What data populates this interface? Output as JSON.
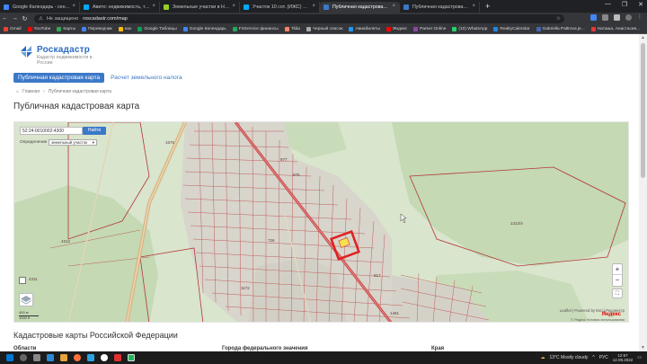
{
  "browser": {
    "tabs": [
      {
        "label": "Google Календарь - сентябрь",
        "color": "#4285f4"
      },
      {
        "label": "Авито: недвижимость, транспо",
        "color": "#00aaff"
      },
      {
        "label": "Земельные участки в Нижнем",
        "color": "#97cf26"
      },
      {
        "label": "Участок 10 сот. (ИЖС) на прод",
        "color": "#00aaff"
      },
      {
        "label": "Публичная кадастровая карта",
        "color": "#3c78c8"
      },
      {
        "label": "Публичная кадастровая карта",
        "color": "#3c78c8"
      }
    ],
    "active_tab": 4,
    "not_secure": "Не защищено",
    "url": "roscadastr.com/map",
    "bookmarks": [
      {
        "label": "Gmail",
        "color": "#ea4335"
      },
      {
        "label": "YouTube",
        "color": "#ff0000"
      },
      {
        "label": "Карты",
        "color": "#34a853"
      },
      {
        "label": "Переводчик",
        "color": "#4285f4"
      },
      {
        "label": "нах",
        "color": "#fbbc05"
      },
      {
        "label": "Google Таблицы",
        "color": "#0f9d58"
      },
      {
        "label": "Google Календарь",
        "color": "#4285f4"
      },
      {
        "label": "FSService финансы",
        "color": "#26a65b"
      },
      {
        "label": "Tilda",
        "color": "#ff8562"
      },
      {
        "label": "Черный список",
        "color": "#aaaaaa"
      },
      {
        "label": "Авиабилеты",
        "color": "#2196f3"
      },
      {
        "label": "Яндекс",
        "color": "#ff0000"
      },
      {
        "label": "Parser Online",
        "color": "#8e44ad"
      },
      {
        "label": "(10) WhatsApp",
        "color": "#25d366"
      },
      {
        "label": "RealtyCalendar",
        "color": "#1e88e5"
      },
      {
        "label": "Gabriella Paltrova je...",
        "color": "#4267b2"
      },
      {
        "label": "Наташа, Анастасия...",
        "color": "#e53935"
      }
    ]
  },
  "site": {
    "logo_title": "Роскадастр",
    "logo_subtitle": "Кадастр недвижимости в России",
    "tabs": [
      {
        "label": "Публичная кадастровая карта",
        "active": true
      },
      {
        "label": "Расчет земельного налога",
        "active": false
      }
    ],
    "breadcrumb": {
      "home": "Главная",
      "current": "Публичная кадастровая карта"
    },
    "page_title": "Публичная кадастровая карта"
  },
  "map": {
    "search_value": "52:24:0010002:4300",
    "find_label": "Найти",
    "definition_label": "Определение",
    "definition_value": "земельный участок",
    "zoom_in": "+",
    "zoom_out": "−",
    "parcel_labels": [
      "1576",
      "4312",
      "1312/4",
      "4311",
      "726",
      "1172",
      "817",
      "977",
      "976",
      "1461"
    ],
    "scale": {
      "top": "400 м",
      "bottom": "1000 ft"
    },
    "attribution": "Leaflet | Powered by Esri | Росреестр",
    "yandex": "Яндекс",
    "terms": "© Яндекс  Условия использования"
  },
  "below": {
    "section_title": "Кадастровые карты Российской Федерации",
    "columns": [
      "Области",
      "Города федерального значения",
      "Края"
    ]
  },
  "taskbar": {
    "weather": "13°C  Mostly cloudy",
    "lang": "РУС",
    "time": "12:57",
    "date": "12.09.2022"
  }
}
